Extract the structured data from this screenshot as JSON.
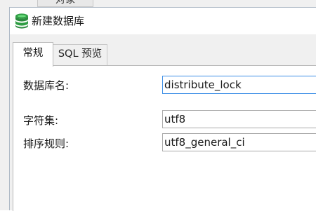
{
  "background": {
    "tab_label": "对象"
  },
  "dialog": {
    "title": "新建数据库",
    "icon": "database-icon",
    "tabs": [
      {
        "label": "常规",
        "active": true
      },
      {
        "label": "SQL 预览",
        "active": false
      }
    ],
    "fields": {
      "db_name_label": "数据库名:",
      "db_name_value": "distribute_lock",
      "charset_label": "字符集:",
      "charset_value": "utf8",
      "collation_label": "排序规则:",
      "collation_value": "utf8_general_ci"
    }
  },
  "colors": {
    "icon_green": "#2f9e44",
    "focus_border": "#3b8ee6",
    "dialog_bg": "#f0f0f0"
  }
}
